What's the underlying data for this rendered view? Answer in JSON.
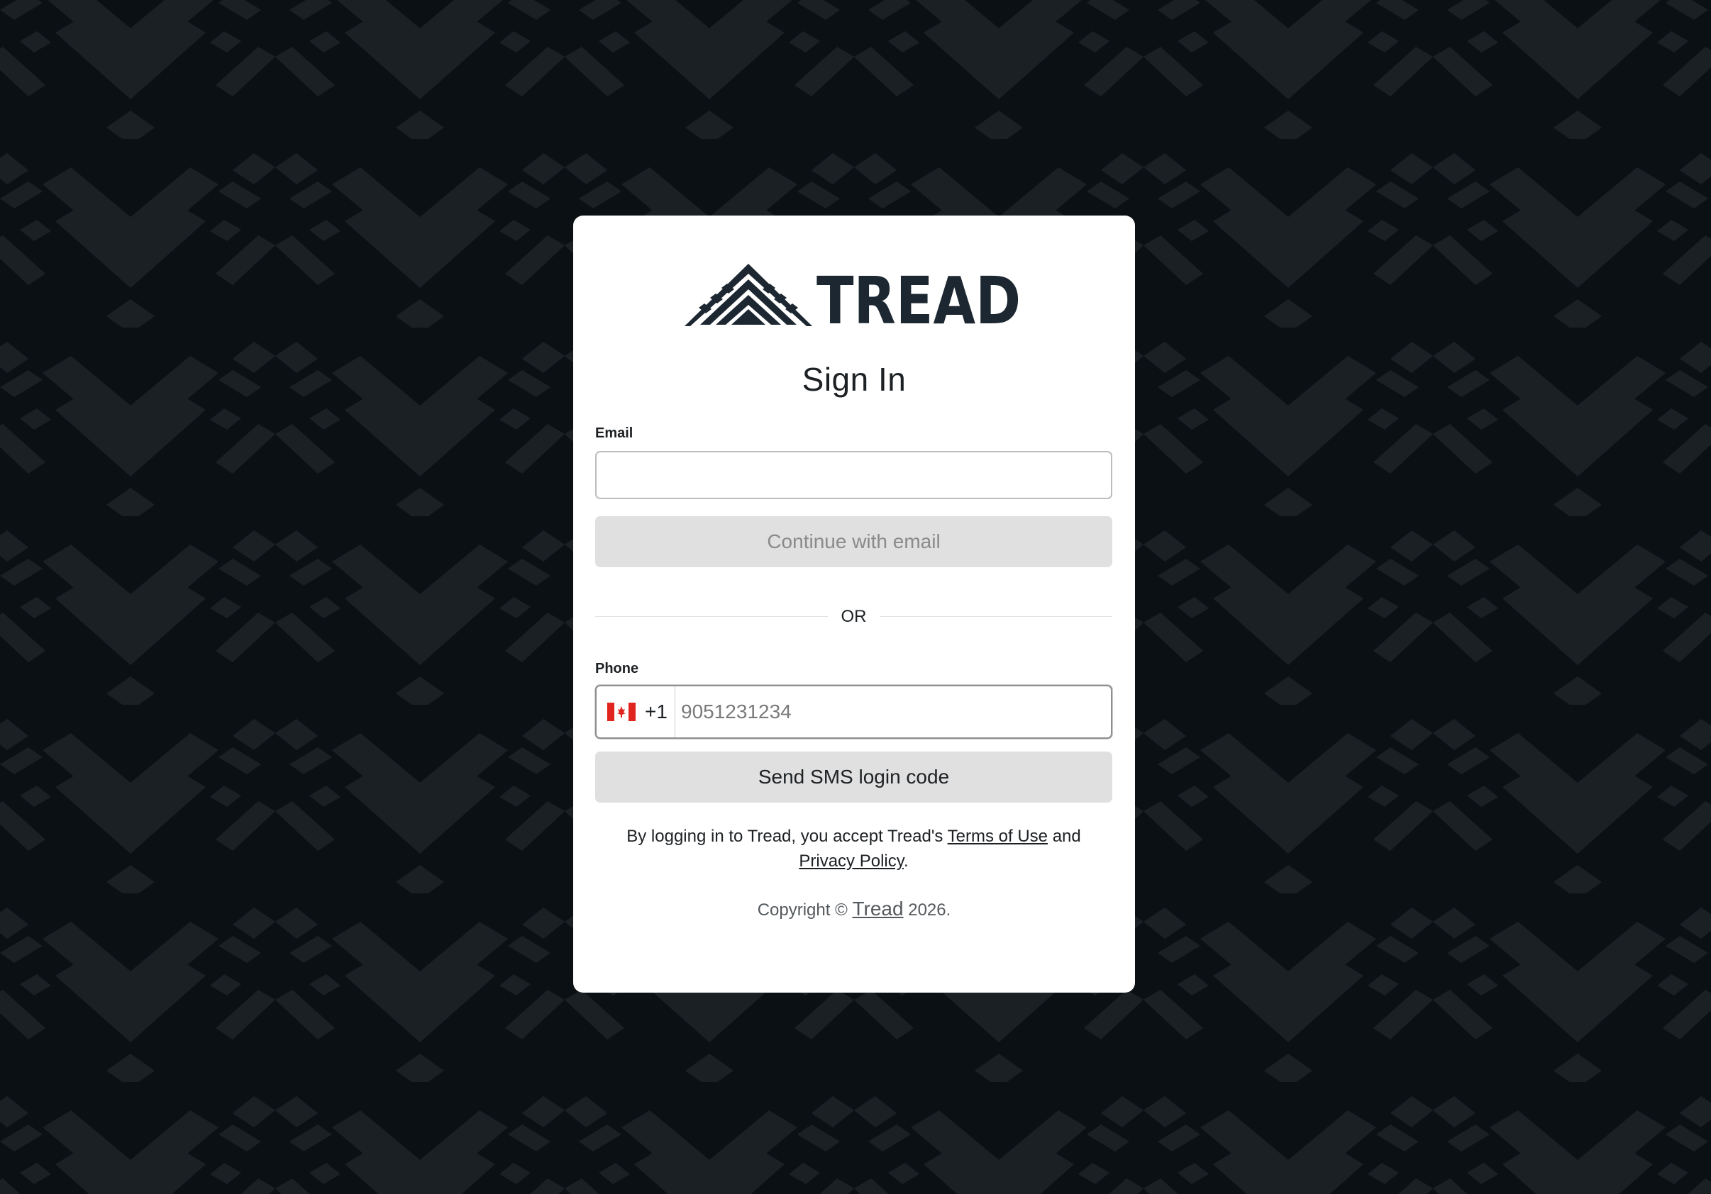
{
  "colors": {
    "background": "#0b1015",
    "pattern": "#1b2025",
    "card": "#ffffff",
    "brand": "#1d2731",
    "button_bg": "#e0e0e0",
    "flag_red": "#e0241e"
  },
  "logo": {
    "text": "TREAD",
    "icon": "tread-mountain-icon"
  },
  "signin": {
    "title": "Sign In",
    "email_label": "Email",
    "email_value": "",
    "continue_button": "Continue with email",
    "divider_text": "OR",
    "phone_label": "Phone",
    "country_flag": "canada-flag-icon",
    "country_code": "+1",
    "phone_placeholder": "9051231234",
    "sms_button": "Send SMS login code"
  },
  "legal": {
    "prefix": "By logging in to Tread, you accept Tread's ",
    "terms_link": "Terms of Use",
    "middle": " and ",
    "privacy_link": "Privacy Policy",
    "suffix": "."
  },
  "footer": {
    "copyright_prefix": "Copyright © ",
    "brand_link": "Tread",
    "year_suffix": " 2026."
  }
}
